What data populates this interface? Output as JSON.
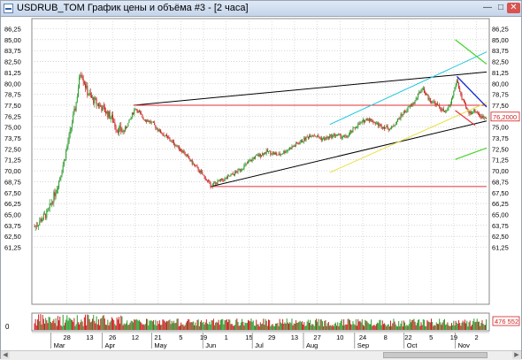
{
  "window": {
    "title": "USDRUB_TOM График цены и объёма #3 - [2 часа]",
    "controls": {
      "minimize": "—",
      "maximize": "□",
      "close": "✕"
    }
  },
  "icons": {
    "app": "chart-icon",
    "scroll_left": "arrow-left-icon",
    "scroll_right": "arrow-right-icon"
  },
  "price_scale": {
    "labels": [
      "86,25",
      "85,00",
      "83,75",
      "82,50",
      "81,25",
      "80,00",
      "78,75",
      "77,50",
      "76,25",
      "75,00",
      "73,75",
      "72,50",
      "71,25",
      "70,00",
      "68,75",
      "67,50",
      "66,25",
      "65,00",
      "63,75",
      "62,50",
      "61,25"
    ],
    "min": 61.25,
    "max": 86.25,
    "step": 1.25
  },
  "current_price": "76,2000",
  "volume_label": "476 552",
  "volume_zero": "0",
  "time_axis": {
    "day_ticks": [
      "28",
      "13",
      "26",
      "12",
      "21",
      "5",
      "19",
      "1",
      "15",
      "29",
      "13",
      "27",
      "10",
      "24",
      "8",
      "22",
      "5",
      "19",
      "2",
      "16",
      "30",
      "14",
      "28",
      "11",
      "25",
      "9",
      "23",
      "6",
      "21",
      "3",
      "17"
    ],
    "months": [
      "Mar",
      "Apr",
      "May",
      "Jun",
      "Jul",
      "Aug",
      "Sep",
      "Oct",
      "Nov"
    ]
  },
  "colors": {
    "support_line": "#000000",
    "horizontal_levels": "#e0303a",
    "upper_channel": "#1ec8dc",
    "lower_channel": "#e8e040",
    "green_marks": "#46d42a",
    "blue_trend": "#1a30d0",
    "candle_up": "#2a9a2a",
    "candle_down": "#cc2020",
    "price_tag": "#d01e1e"
  },
  "chart_data": {
    "type": "candlestick",
    "title": "USDRUB_TOM",
    "timeframe": "2 часа",
    "ylim": [
      61.25,
      86.25
    ],
    "price_path": [
      {
        "x": "Feb 20",
        "y": 63.6
      },
      {
        "x": "Feb 28",
        "y": 65.2
      },
      {
        "x": "Mar 5",
        "y": 68.3
      },
      {
        "x": "Mar 9",
        "y": 71.2
      },
      {
        "x": "Mar 13",
        "y": 74.8
      },
      {
        "x": "Mar 16",
        "y": 77.5
      },
      {
        "x": "Mar 19",
        "y": 81.5
      },
      {
        "x": "Mar 23",
        "y": 79.0
      },
      {
        "x": "Mar 26",
        "y": 78.2
      },
      {
        "x": "Apr 2",
        "y": 77.0
      },
      {
        "x": "Apr 7",
        "y": 76.0
      },
      {
        "x": "Apr 10",
        "y": 74.8
      },
      {
        "x": "Apr 14",
        "y": 74.5
      },
      {
        "x": "Apr 17",
        "y": 75.5
      },
      {
        "x": "Apr 21",
        "y": 77.2
      },
      {
        "x": "Apr 26",
        "y": 76.0
      },
      {
        "x": "May 1",
        "y": 75.5
      },
      {
        "x": "May 6",
        "y": 74.5
      },
      {
        "x": "May 14",
        "y": 73.2
      },
      {
        "x": "May 20",
        "y": 72.2
      },
      {
        "x": "May 26",
        "y": 70.8
      },
      {
        "x": "Jun 1",
        "y": 69.5
      },
      {
        "x": "Jun 6",
        "y": 68.3
      },
      {
        "x": "Jun 11",
        "y": 68.8
      },
      {
        "x": "Jun 16",
        "y": 69.2
      },
      {
        "x": "Jun 21",
        "y": 69.8
      },
      {
        "x": "Jun 26",
        "y": 70.5
      },
      {
        "x": "Jul 2",
        "y": 71.5
      },
      {
        "x": "Jul 10",
        "y": 72.2
      },
      {
        "x": "Jul 17",
        "y": 71.8
      },
      {
        "x": "Jul 24",
        "y": 72.6
      },
      {
        "x": "Jul 31",
        "y": 73.4
      },
      {
        "x": "Aug 6",
        "y": 74.2
      },
      {
        "x": "Aug 13",
        "y": 73.6
      },
      {
        "x": "Aug 20",
        "y": 74.1
      },
      {
        "x": "Aug 27",
        "y": 73.8
      },
      {
        "x": "Sep 2",
        "y": 75.1
      },
      {
        "x": "Sep 9",
        "y": 76.0
      },
      {
        "x": "Sep 16",
        "y": 75.2
      },
      {
        "x": "Sep 23",
        "y": 74.8
      },
      {
        "x": "Sep 30",
        "y": 76.5
      },
      {
        "x": "Oct 7",
        "y": 77.8
      },
      {
        "x": "Oct 12",
        "y": 79.5
      },
      {
        "x": "Oct 16",
        "y": 78.2
      },
      {
        "x": "Oct 21",
        "y": 77.5
      },
      {
        "x": "Oct 26",
        "y": 76.6
      },
      {
        "x": "Oct 29",
        "y": 77.6
      },
      {
        "x": "Nov 2",
        "y": 80.4
      },
      {
        "x": "Nov 5",
        "y": 78.2
      },
      {
        "x": "Nov 9",
        "y": 76.6
      },
      {
        "x": "Nov 13",
        "y": 76.9
      },
      {
        "x": "Nov 17",
        "y": 76.1
      },
      {
        "x": "Nov 20",
        "y": 76.2
      }
    ]
  }
}
